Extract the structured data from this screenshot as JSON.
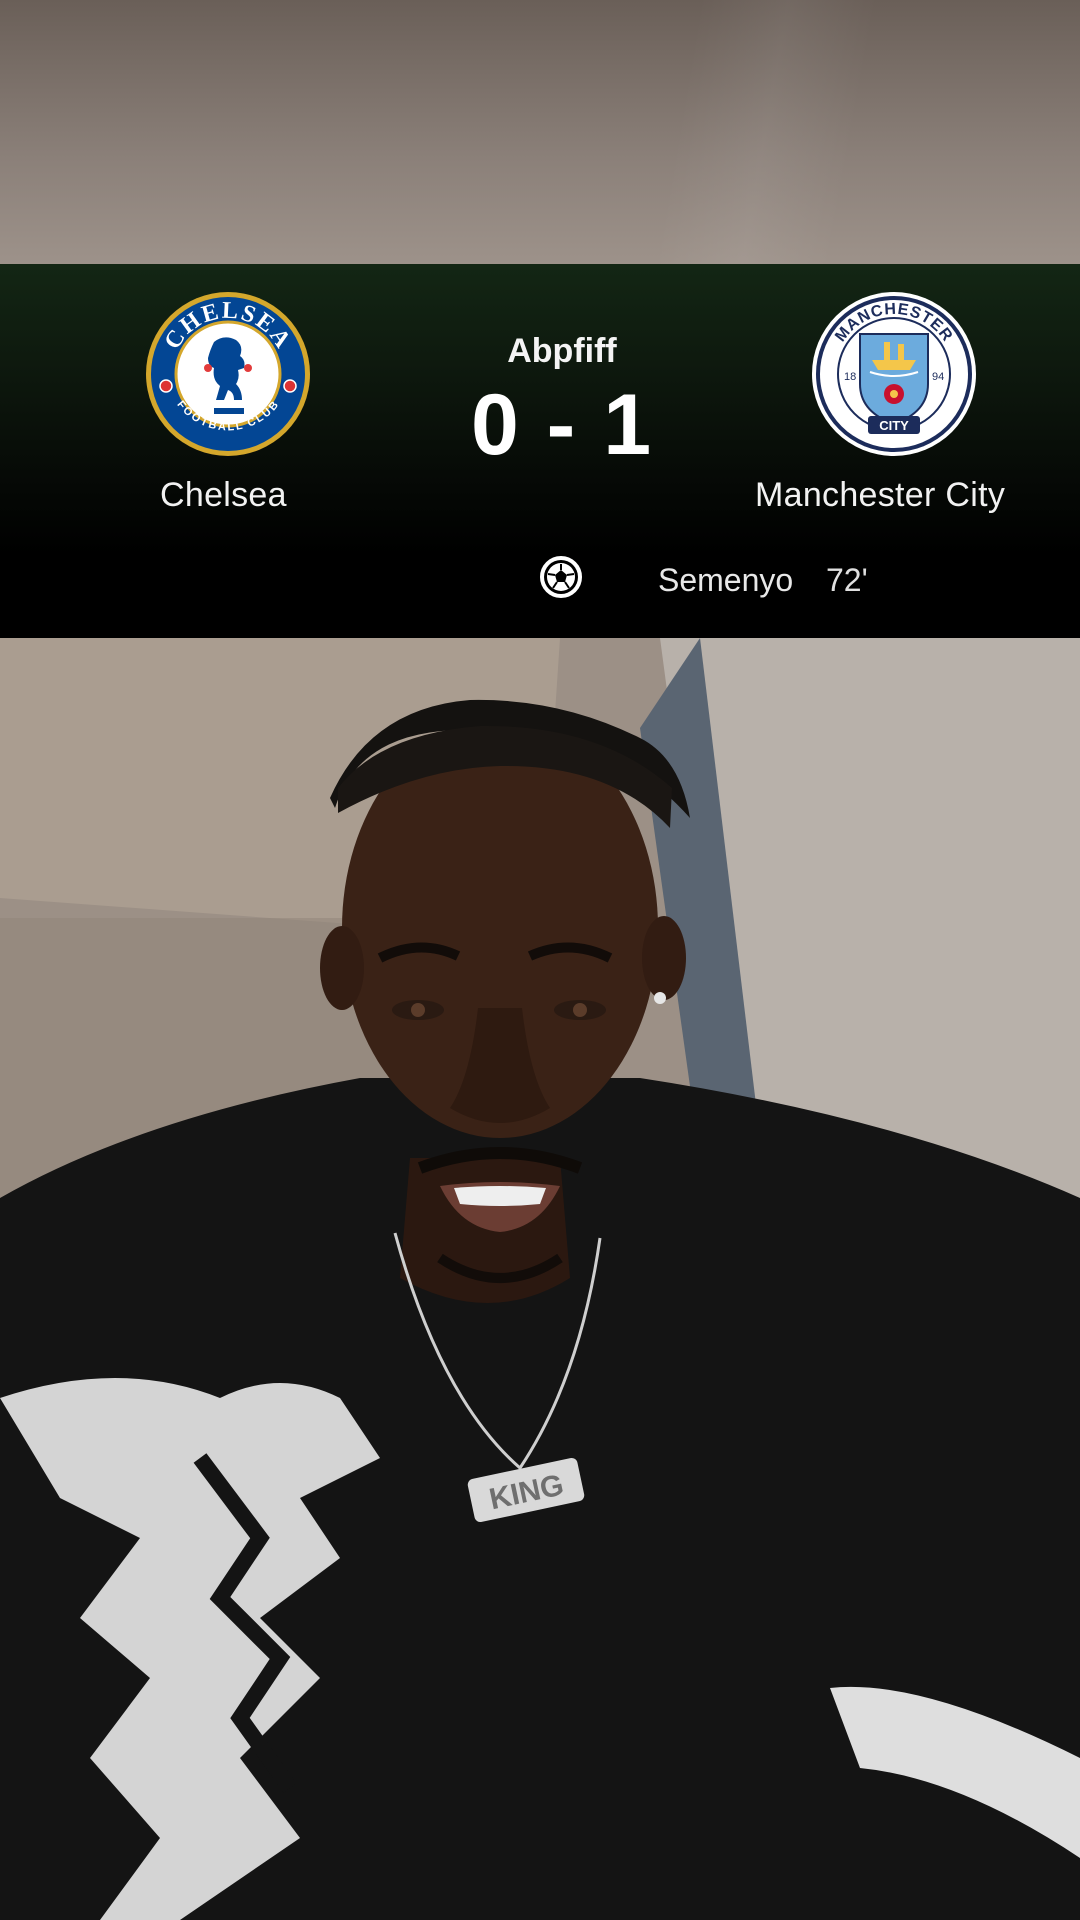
{
  "match": {
    "status": "Abpfiff",
    "score": "0 - 1",
    "home_team": {
      "name": "Chelsea",
      "crest_text_top": "CHELSEA",
      "crest_text_bottom": "FOOTBALL CLUB"
    },
    "away_team": {
      "name": "Manchester City",
      "crest_text_top": "MANCHESTER",
      "crest_text_bottom": "CITY",
      "crest_year_left": "18",
      "crest_year_right": "94"
    },
    "goal": {
      "icon": "soccer-ball-icon",
      "scorer": "Semenyo",
      "minute": "72'"
    }
  },
  "video": {
    "necklace_text": "KING"
  },
  "colors": {
    "chelsea_blue": "#034694",
    "chelsea_gold": "#d4a72c",
    "city_blue": "#6cabdd",
    "city_navy": "#1c2c5b",
    "scoreboard_green": "#132614"
  }
}
